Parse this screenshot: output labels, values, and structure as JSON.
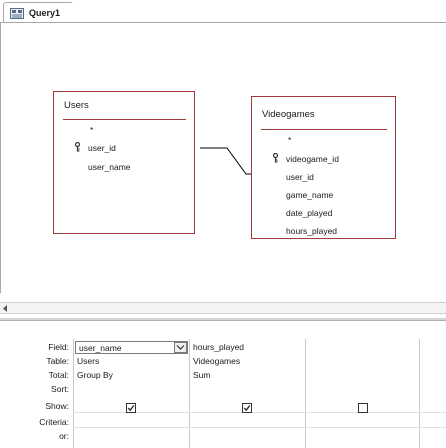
{
  "tab": {
    "label": "Query1",
    "icon": "query-design-icon"
  },
  "tables": [
    {
      "title": "Users",
      "fields": [
        {
          "label": "*",
          "key": false
        },
        {
          "label": "user_id",
          "key": true
        },
        {
          "label": "user_name",
          "key": false
        }
      ]
    },
    {
      "title": "Videogames",
      "fields": [
        {
          "label": "*",
          "key": false
        },
        {
          "label": "videogame_id",
          "key": true
        },
        {
          "label": "user_id",
          "key": false
        },
        {
          "label": "game_name",
          "key": false
        },
        {
          "label": "date_played",
          "key": false
        },
        {
          "label": "hours_played",
          "key": false
        }
      ]
    }
  ],
  "grid": {
    "row_labels": [
      "Field:",
      "Table:",
      "Total:",
      "Sort:",
      "Show:",
      "Criteria:",
      "or:"
    ],
    "columns": [
      {
        "field": "user_name",
        "table": "Users",
        "total": "Group By",
        "sort": "",
        "show": true
      },
      {
        "field": "hours_played",
        "table": "Videogames",
        "total": "Sum",
        "sort": "",
        "show": true
      },
      {
        "field": "",
        "table": "",
        "total": "",
        "sort": "",
        "show": false
      }
    ]
  },
  "colors": {
    "table_border": "#9e3a3a",
    "grid_lines": "#c9c9c9"
  }
}
